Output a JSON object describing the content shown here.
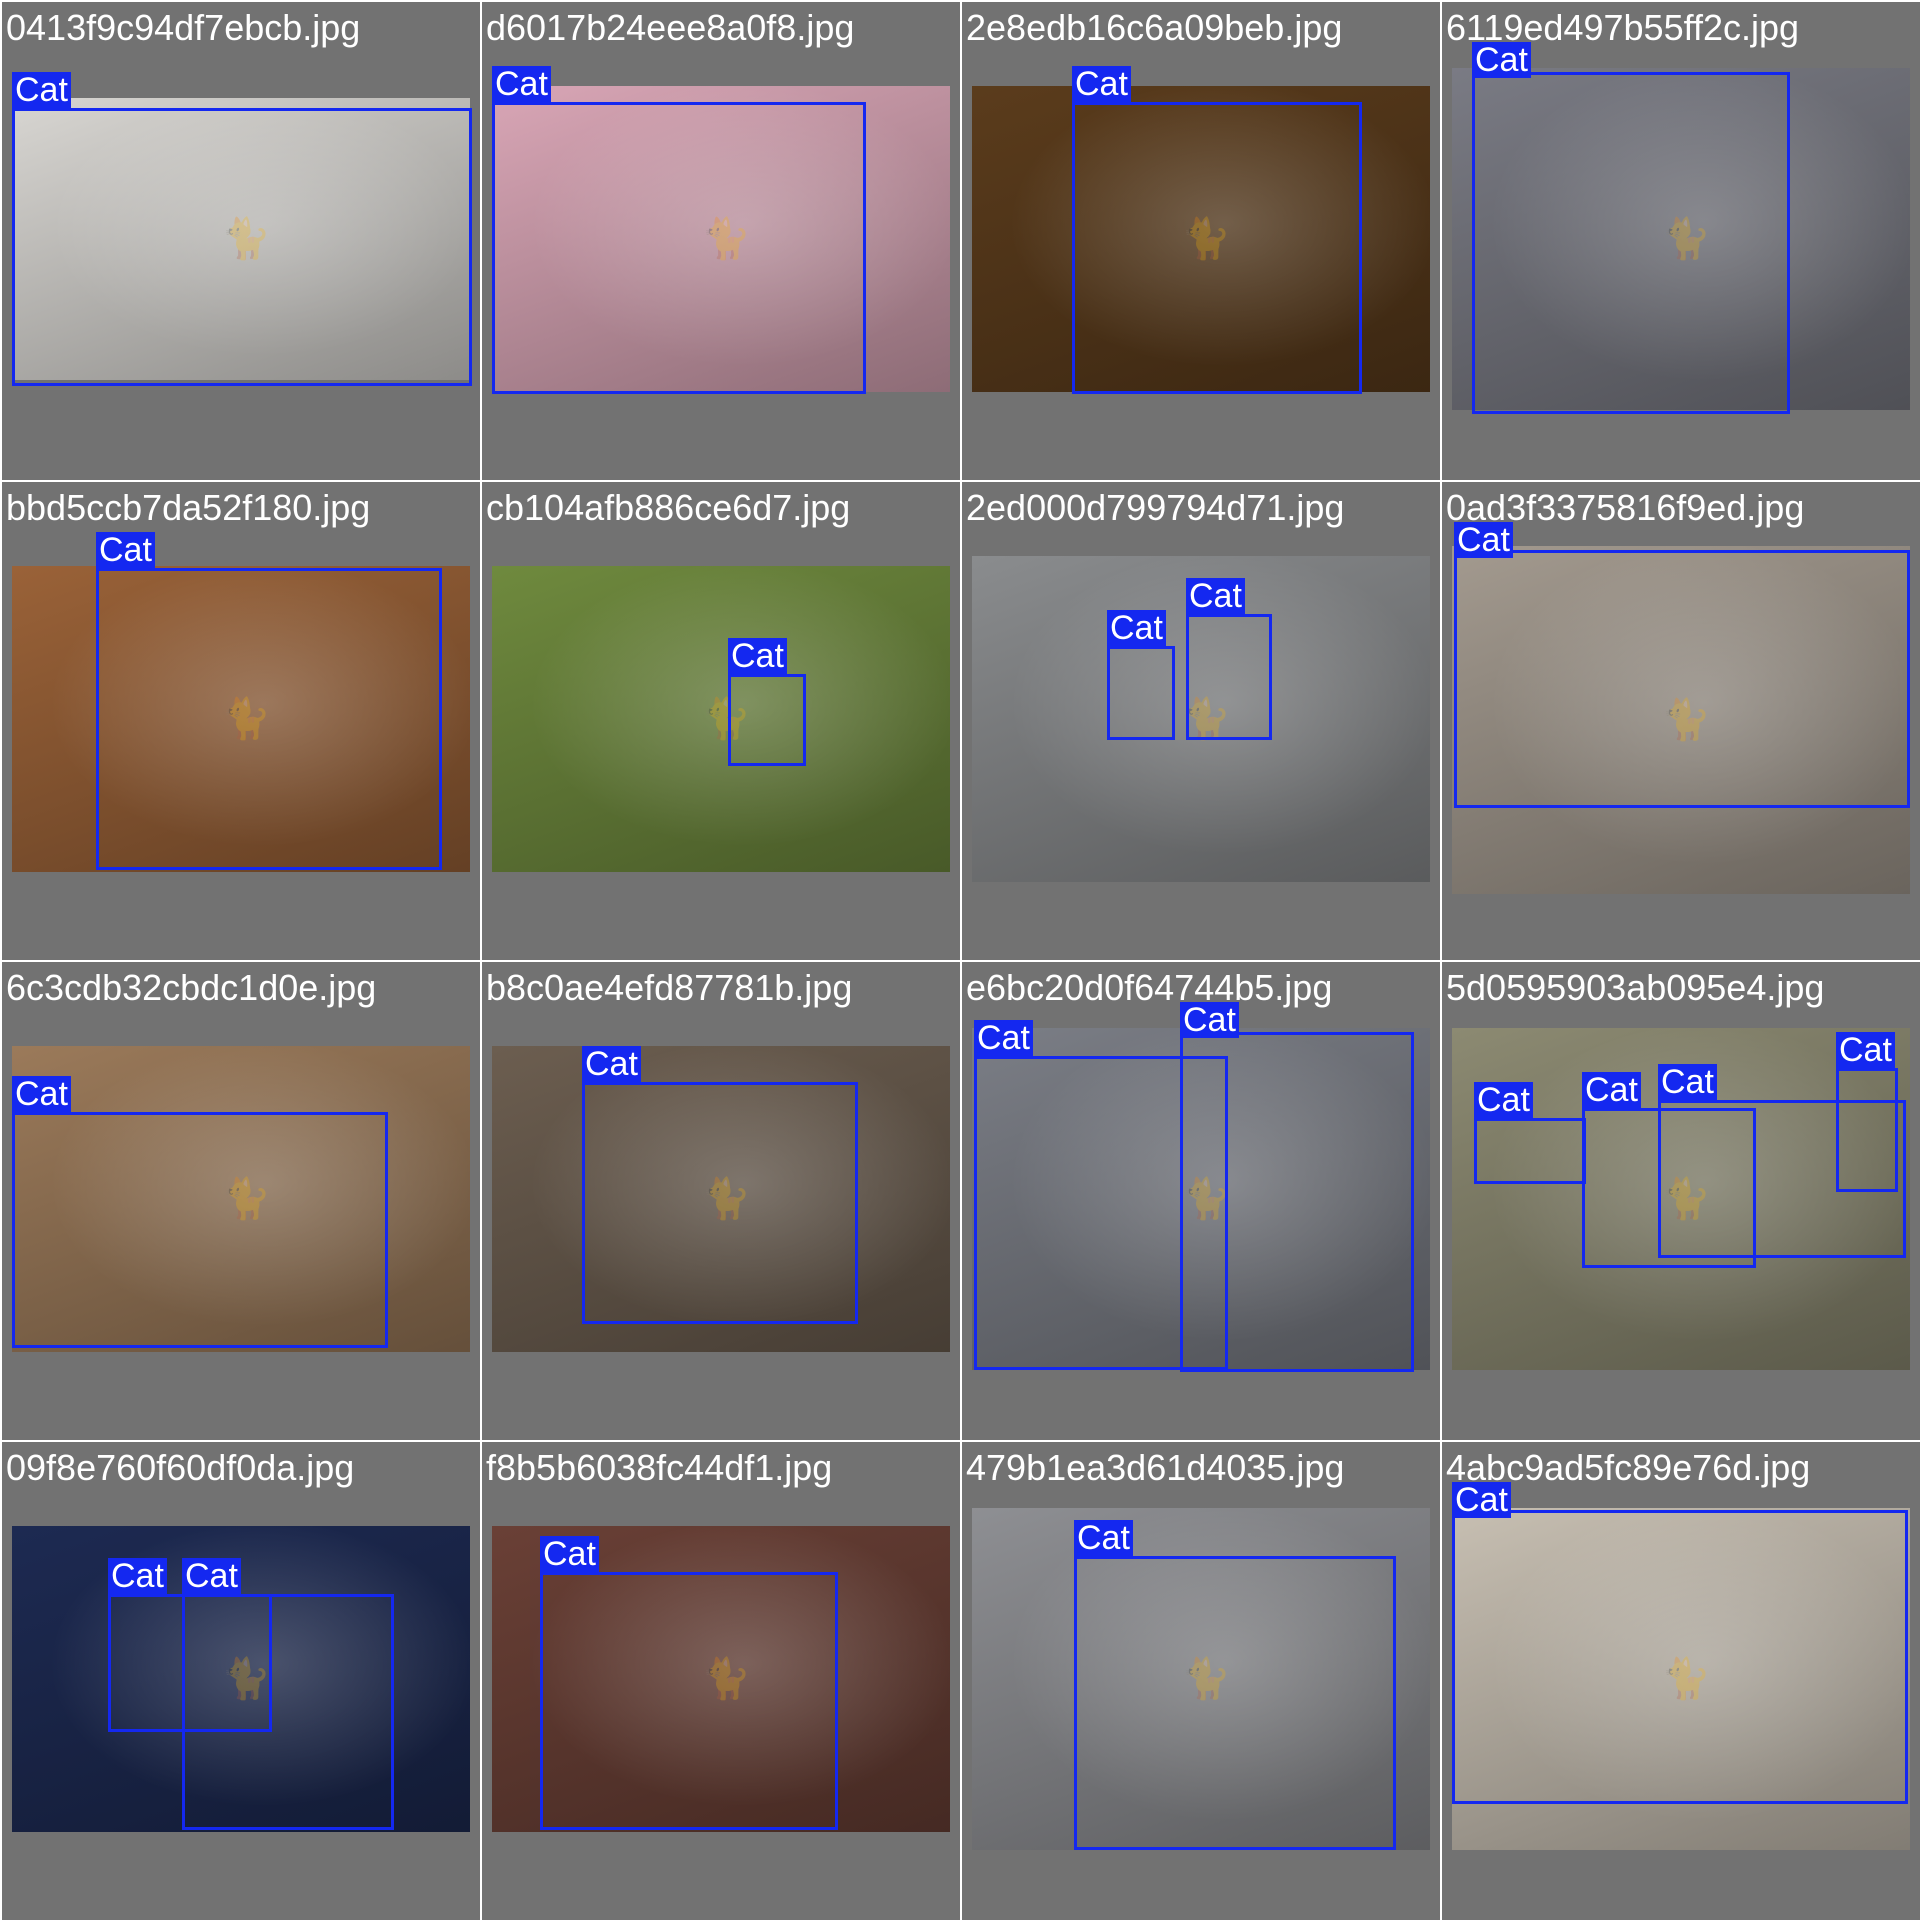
{
  "palette": {
    "tile_background": "#727272",
    "box_color": "#1428f0",
    "box_color_alt": "#16d6e6",
    "text_color": "#ffffff"
  },
  "icons": {
    "photo": "cat-photo-icon"
  },
  "grid": {
    "tiles": [
      {
        "filename": "0413f9c94df7ebcb.jpg",
        "photo_color": "#d8d6d2",
        "detections": [
          {
            "label": "Cat"
          }
        ]
      },
      {
        "filename": "d6017b24eee8a0f8.jpg",
        "photo_color": "#d9a6b6",
        "detections": [
          {
            "label": "Cat"
          }
        ]
      },
      {
        "filename": "2e8edb16c6a09beb.jpg",
        "photo_color": "#5b3c1c",
        "detections": [
          {
            "label": "Cat"
          }
        ]
      },
      {
        "filename": "6119ed497b55ff2c.jpg",
        "photo_color": "#7a7b84",
        "detections": [
          {
            "label": "Cat"
          }
        ]
      },
      {
        "filename": "bbd5ccb7da52f180.jpg",
        "photo_color": "#9a6238",
        "detections": [
          {
            "label": "Cat"
          }
        ]
      },
      {
        "filename": "cb104afb886ce6d7.jpg",
        "photo_color": "#6f8a3e",
        "detections": [
          {
            "label": "Cat"
          }
        ]
      },
      {
        "filename": "2ed000d799794d71.jpg",
        "photo_color": "#8a8c8e",
        "detections": [
          {
            "label": "Cat"
          },
          {
            "label": "Cat"
          }
        ]
      },
      {
        "filename": "0ad3f3375816f9ed.jpg",
        "photo_color": "#a39a8f",
        "detections": [
          {
            "label": "Cat"
          }
        ]
      },
      {
        "filename": "6c3cdb32cbdc1d0e.jpg",
        "photo_color": "#9b7a5a",
        "detections": [
          {
            "label": "Cat"
          }
        ]
      },
      {
        "filename": "b8c0ae4efd87781b.jpg",
        "photo_color": "#6c5e50",
        "detections": [
          {
            "label": "Cat"
          }
        ]
      },
      {
        "filename": "e6bc20d0f64744b5.jpg",
        "photo_color": "#7b7e86",
        "detections": [
          {
            "label": "Cat"
          },
          {
            "label": "Cat"
          }
        ]
      },
      {
        "filename": "5d0595903ab095e4.jpg",
        "photo_color": "#8c8a72",
        "detections": [
          {
            "label": "Cat"
          },
          {
            "label": "Cat"
          },
          {
            "label": "Cat"
          },
          {
            "label": "Cat"
          }
        ]
      },
      {
        "filename": "09f8e760f60df0da.jpg",
        "photo_color": "#1d2a52",
        "detections": [
          {
            "label": "Cat"
          },
          {
            "label": "Cat"
          }
        ]
      },
      {
        "filename": "f8b5b6038fc44df1.jpg",
        "photo_color": "#6a4036",
        "detections": [
          {
            "label": "Cat"
          }
        ]
      },
      {
        "filename": "479b1ea3d61d4035.jpg",
        "photo_color": "#8e8f93",
        "detections": [
          {
            "label": "Cat"
          }
        ]
      },
      {
        "filename": "4abc9ad5fc89e76d.jpg",
        "photo_color": "#c7bfb2",
        "detections": [
          {
            "label": "Cat"
          }
        ]
      }
    ]
  }
}
